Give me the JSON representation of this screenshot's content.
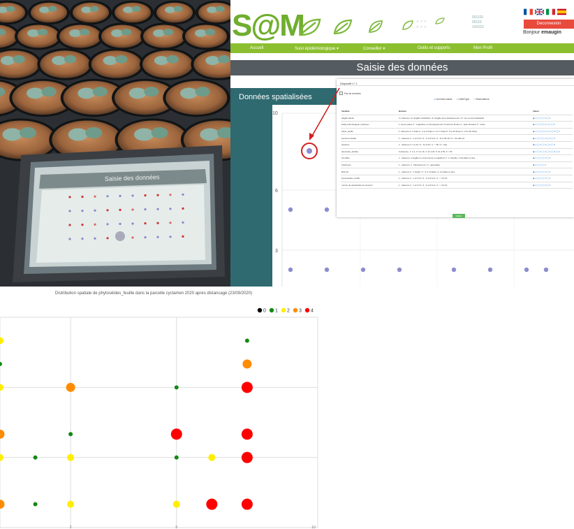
{
  "screenshot": {
    "logo_text": "S@M",
    "header_codes": [
      "001101",
      "00110",
      "101010"
    ],
    "header_small_text": [
      "✓ ✓ ✓",
      "✓ ✓ ✓"
    ],
    "logout_label": "Deconnexion",
    "greeting_prefix": "Bonjour ",
    "greeting_user": "emaugin",
    "nav": [
      "Accueil",
      "Suivi épidémiologique ▾",
      "Conseiller ▾",
      "Outils et supports",
      "Mon Profil"
    ],
    "page_title": "Saisie des données",
    "section_title": "Données spatialisées",
    "axis_label_y": "y",
    "y_ticks": [
      "10",
      "6",
      "3"
    ],
    "popup": {
      "title": "Dispositif n° 1",
      "checkbox_label": "Pas de données",
      "radio_options": [
        "Données saisie",
        "Unité/Type",
        "Observations"
      ],
      "columns": [
        "Variable",
        "Barème",
        "Valeur"
      ],
      "rows": [
        [
          "dégâts plante",
          "1= absence, 2= dégâts réduisibles, 3= dégâts avec déclassement, 4= non commercialisable",
          "◉ 1 ◯ 2 ◯ 3 ◯ 4"
        ],
        [
          "stade phénologique cyclamen",
          "1: jeune plante 2 : végétative en développement 3 boutons floraux 4 : plein floraison 5 : sortie",
          "◉ 1 ◯ 2 ◯ 3 ◯ 4 ◯ 5"
        ],
        [
          "thrips_feuille",
          "1: absence 2: 1 thrips 3 : 2 à 3 thrips 4: 4 à 7 thrips 5 : 8 à 15 thrips 6 : 16 à 30 thrips",
          "◉ 1 ◯ 2 ◯ 3 ◯ 4 ◯ 5 ◯ 6"
        ],
        [
          "pucerons feuille",
          "1 : absence 2 : 1 à 3 ind / 3 : 4 à 10 ind / 4 : 11 à 30 ind / 5 : 31-100 ind",
          "◉ 1 ◯ 2 ◯ 3 ◯ 4 ◯ 5"
        ],
        [
          "acariens",
          "1 : absence 2: 1 à 10 / 3 : 11 à 50 / 4 : > 50 / 5 : toile",
          "◉ 1 ◯ 2 ◯ 3 ◯ 4 ◯ 5"
        ],
        [
          "aleurodes_feuilles",
          "0 absence, 1: 1-2, 3: 3 à 10, 4: 11 à 20, 5: 21 à 50, 6 > 50",
          "◉ 1 ◯ 2 ◯ 3 ◯ 4 ◯ 5 ◯ 6"
        ],
        [
          "chenilles",
          "1 : absence, 2 dégâts ou excréments ou papillons 3 : 1 chenille, 4 chenilles et plus",
          "◉ 1 ◯ 2 ◯ 3 ◯ 4"
        ],
        [
          "fusarioses",
          "1 : absence, 2 : flétrissement / 3 : généralisé",
          "◉ 1 ◯ 2 ◯ 3"
        ],
        [
          "Botrytis",
          "1 : absence 2 : 1 feuille / 3 : 2-3 / feuilles, 4: 4 feuilles et plus",
          "◉ 1 ◯ 2 ◯ 3 ◯ 4"
        ],
        [
          "phytoseiides_feuille",
          "1 : absence 2 : 1 à 3 ind / 3 : 4 à 10 ind / 4 : > 10 ind",
          "◉ 1 ◯ 2 ◯ 3 ◯ 4"
        ],
        [
          "momie de parasitoïde de puceron",
          "1 : absence 2 : 1 à 3 ind / 3 : 4 à 10 ind / 4 : > 10 ind",
          "◉ 1 ◯ 2 ◯ 3 ◯ 4"
        ]
      ],
      "validate_label": "Valider"
    },
    "colors": {
      "brand_green": "#6fae2e",
      "nav_green": "#8cbf2f",
      "logout_red": "#e84a3c",
      "teal": "#2e6a70",
      "point_purple": "#8c8ccf"
    }
  },
  "tablet_screen": {
    "title": "Saisie des données"
  },
  "chart_data": {
    "type": "scatter",
    "title": "Distribution spatiale de phytoséides_feuille dans la parcelle cyclamen 2020 apres distancage (23/09/2020)",
    "legend_position": "top-right",
    "legend": [
      {
        "label": "0",
        "color": "#000000"
      },
      {
        "label": "1",
        "color": "#138a13"
      },
      {
        "label": "2",
        "color": "#ffee00"
      },
      {
        "label": "3",
        "color": "#ff8c00"
      },
      {
        "label": "4",
        "color": "#ff0000"
      }
    ],
    "x_ticks": [
      "2",
      "5",
      "10"
    ],
    "xlim": [
      1,
      10
    ],
    "ylim": [
      1,
      10
    ],
    "grid": true,
    "points": [
      {
        "x": 1,
        "y": 9,
        "class": 2
      },
      {
        "x": 8,
        "y": 9,
        "class": 1
      },
      {
        "x": 1,
        "y": 8,
        "class": 1
      },
      {
        "x": 8,
        "y": 8,
        "class": 3
      },
      {
        "x": 1,
        "y": 7,
        "class": 2
      },
      {
        "x": 3,
        "y": 7,
        "class": 3
      },
      {
        "x": 6,
        "y": 7,
        "class": 1
      },
      {
        "x": 8,
        "y": 7,
        "class": 4
      },
      {
        "x": 1,
        "y": 5,
        "class": 3
      },
      {
        "x": 3,
        "y": 5,
        "class": 1
      },
      {
        "x": 6,
        "y": 5,
        "class": 4
      },
      {
        "x": 8,
        "y": 5,
        "class": 4
      },
      {
        "x": 1,
        "y": 4,
        "class": 2
      },
      {
        "x": 2,
        "y": 4,
        "class": 1
      },
      {
        "x": 3,
        "y": 4,
        "class": 2
      },
      {
        "x": 6,
        "y": 4,
        "class": 1
      },
      {
        "x": 7,
        "y": 4,
        "class": 2
      },
      {
        "x": 8,
        "y": 4,
        "class": 4
      },
      {
        "x": 1,
        "y": 2,
        "class": 3
      },
      {
        "x": 2,
        "y": 2,
        "class": 1
      },
      {
        "x": 3,
        "y": 2,
        "class": 2
      },
      {
        "x": 6,
        "y": 2,
        "class": 2
      },
      {
        "x": 7,
        "y": 2,
        "class": 4
      },
      {
        "x": 8,
        "y": 2,
        "class": 4
      }
    ]
  }
}
